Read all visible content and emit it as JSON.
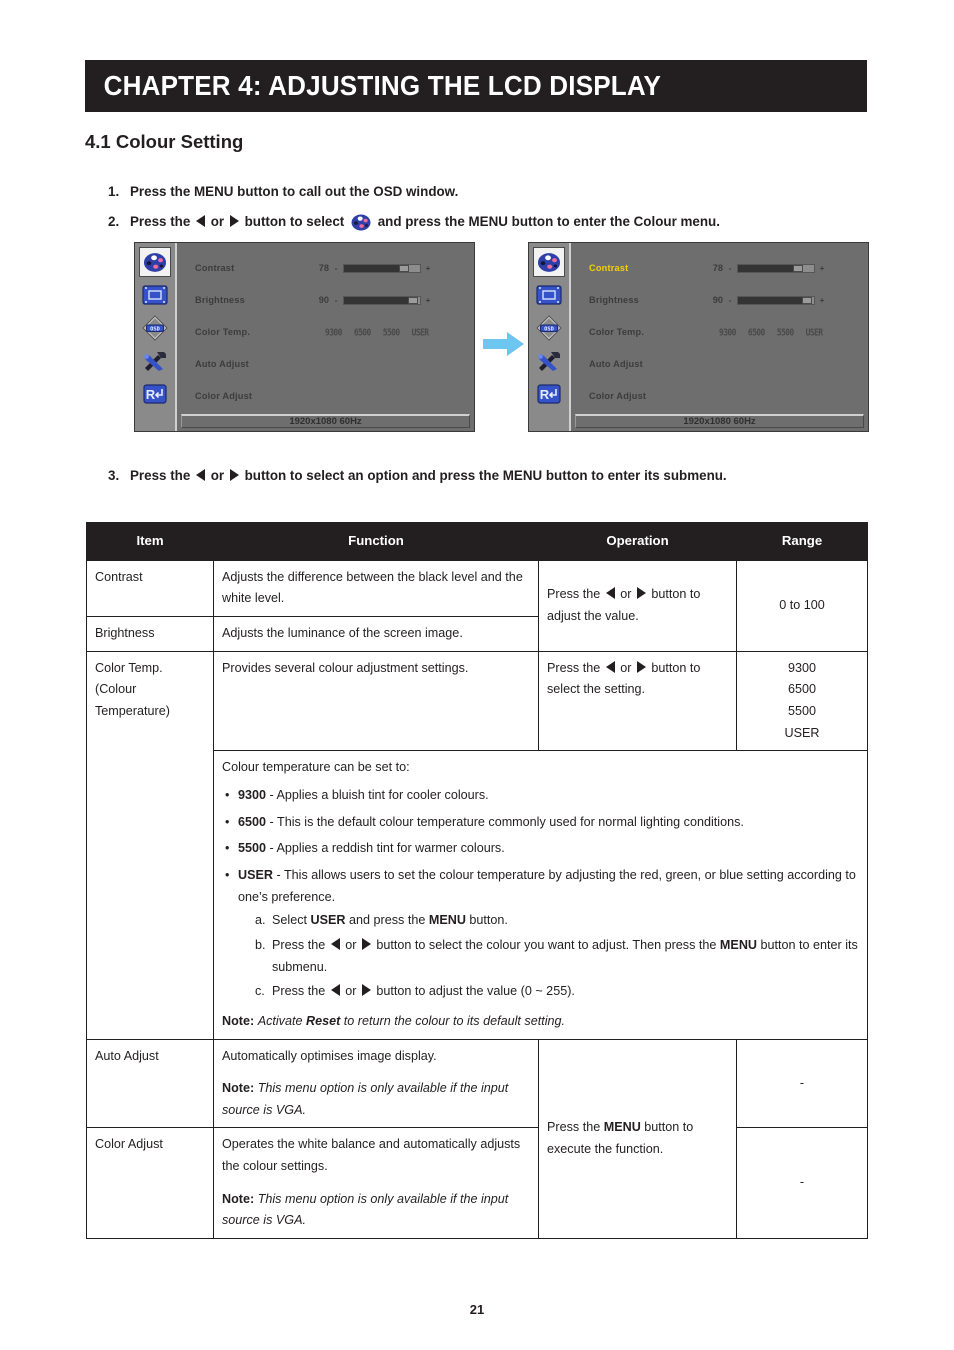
{
  "chapter": {
    "title": "CHAPTER 4: ADJUSTING THE LCD DISPLAY"
  },
  "section": {
    "heading": "4.1 Colour Setting"
  },
  "steps": [
    {
      "num": "1.",
      "parts": [
        {
          "t": "text",
          "v": "Press the MENU button to call out the OSD window."
        }
      ]
    },
    {
      "num": "2.",
      "parts": [
        {
          "t": "text",
          "v": "Press the "
        },
        {
          "t": "tri-left"
        },
        {
          "t": "text",
          "v": " or "
        },
        {
          "t": "tri-right"
        },
        {
          "t": "text",
          "v": " button to select "
        },
        {
          "t": "palette-icon"
        },
        {
          "t": "text",
          "v": " and press the MENU button to enter the Colour menu."
        }
      ]
    },
    {
      "num": "3.",
      "parts": [
        {
          "t": "text",
          "v": "Press the "
        },
        {
          "t": "tri-left"
        },
        {
          "t": "text",
          "v": " or "
        },
        {
          "t": "tri-right"
        },
        {
          "t": "text",
          "v": " button to select an option and press the MENU button to enter its submenu."
        }
      ]
    }
  ],
  "osd": {
    "sidebar_icons": [
      {
        "name": "colour-palette-icon",
        "selected": true
      },
      {
        "name": "display-screen-icon",
        "selected": false
      },
      {
        "name": "osd-settings-icon",
        "selected": false
      },
      {
        "name": "tools-icon",
        "selected": false
      },
      {
        "name": "reset-icon",
        "selected": false
      }
    ],
    "rows": [
      {
        "label": "Contrast",
        "value": "78",
        "minus": "-",
        "plus": "+",
        "percent": 78,
        "type": "slider"
      },
      {
        "label": "Brightness",
        "value": "90",
        "minus": "-",
        "plus": "+",
        "percent": 90,
        "type": "slider"
      },
      {
        "label": "Color Temp.",
        "type": "temps",
        "options": [
          "9300",
          "6500",
          "5500",
          "USER"
        ]
      },
      {
        "label": "Auto Adjust",
        "type": "plain"
      },
      {
        "label": "Color Adjust",
        "type": "plain"
      }
    ],
    "status": "1920x1080  60Hz",
    "highlighted_row_right": "Contrast",
    "highlight_color": "#f5d000",
    "panel_color": "#6e6e6e",
    "arrow_color": "#6cc6f0"
  },
  "table": {
    "headers": [
      "Item",
      "Function",
      "Operation",
      "Range"
    ],
    "rows": {
      "contrast": {
        "item": "Contrast",
        "function": "Adjusts the difference between the black level and the white level."
      },
      "brightness": {
        "item": "Brightness",
        "function": "Adjusts the luminance of the screen image."
      },
      "contrast_brightness_operation": "Press the ◀ or ▶ button to adjust the value.",
      "contrast_brightness_range": "0 to 100",
      "color_temp": {
        "item": "Color Temp. (Colour Temperature)",
        "item_line1": "Color Temp.",
        "item_line2": "(Colour",
        "item_line3": "Temperature)",
        "function": "Provides several colour adjustment settings.",
        "operation": "Press the ◀ or ▶ button to select the setting.",
        "range": [
          "9300",
          "6500",
          "5500",
          "USER"
        ]
      },
      "color_temp_detail": {
        "intro": "Colour temperature can be set to:",
        "bullets": [
          {
            "term": "9300",
            "text": " - Applies a bluish tint for cooler colours."
          },
          {
            "term": "6500",
            "text": " - This is the default colour temperature commonly used for normal lighting conditions."
          },
          {
            "term": "5500",
            "text": " - Applies a reddish tint for warmer colours."
          },
          {
            "term": "USER",
            "text": " - This allows users to set the colour temperature by adjusting the red, green, or blue setting according to one’s preference."
          }
        ],
        "substeps": [
          "Select USER and press the MENU button.",
          "Press the ◀ or ▶ button to select the colour you want to adjust. Then press the MENU button to enter its submenu.",
          "Press the ◀ or ▶ button to adjust the value (0 ~ 255)."
        ],
        "note_label": "Note:",
        "note_text": "Activate Reset to return the colour to its default setting."
      },
      "auto_adjust": {
        "item": "Auto Adjust",
        "function": "Automatically optimises image display.",
        "note_label": "Note:",
        "note_text": "This menu option is only available if the input source is VGA.",
        "range": "-"
      },
      "color_adjust": {
        "item": "Color Adjust",
        "function": "Operates the white balance and automatically adjusts the colour settings.",
        "note_label": "Note:",
        "note_text": "This menu option is only available if the input source is VGA.",
        "range": "-"
      },
      "adjust_operation": "Press the MENU button to execute the function."
    }
  },
  "footer": {
    "page_number": "21"
  }
}
